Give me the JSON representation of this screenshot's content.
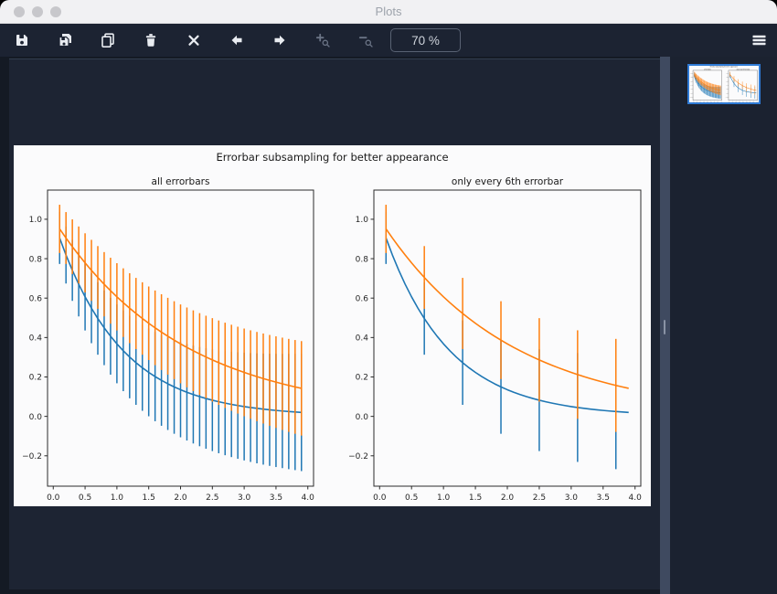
{
  "window": {
    "title": "Plots"
  },
  "toolbar": {
    "zoom_level": "70 %",
    "buttons": [
      {
        "name": "save",
        "icon": "save-icon",
        "enabled": true
      },
      {
        "name": "save-all",
        "icon": "save-all-icon",
        "enabled": true
      },
      {
        "name": "copy",
        "icon": "copy-icon",
        "enabled": true
      },
      {
        "name": "remove-plot",
        "icon": "trash-icon",
        "enabled": true
      },
      {
        "name": "close-all",
        "icon": "close-all-icon",
        "enabled": true
      },
      {
        "name": "previous-plot",
        "icon": "arrow-left-icon",
        "enabled": true
      },
      {
        "name": "next-plot",
        "icon": "arrow-right-icon",
        "enabled": true
      },
      {
        "name": "zoom-in",
        "icon": "zoom-in-icon",
        "enabled": false
      },
      {
        "name": "zoom-out",
        "icon": "zoom-out-icon",
        "enabled": false
      },
      {
        "name": "options-menu",
        "icon": "hamburger-menu-icon",
        "enabled": true
      }
    ]
  },
  "sidebar": {
    "thumbnails": [
      {
        "selected": true
      }
    ]
  },
  "colors": {
    "titlebar_bg": "#f1f1f3",
    "titlebar_text": "#9da3ab",
    "traffic_light": "#c7c7cb",
    "toolbar_bg": "#1c2332",
    "icon": "#e9ecf1",
    "icon_disabled": "#6b7486",
    "content_bg": "#141a24",
    "panel_bg": "#1d2433",
    "splitter": "#3f4a60",
    "sidebar_bg": "#1b2230",
    "thumbnail_border": "#2f7bd6",
    "figure_bg": "#fbfbfc",
    "spine": "#2b2b2b",
    "fig_text": "#1a1a1a",
    "tick_text": "#262626",
    "series_blue": "#1f77b4",
    "series_orange": "#ff7f0e",
    "zoom_box_border": "#596273",
    "zoom_box_text": "#ced3db"
  },
  "chart_data": {
    "type": "line",
    "suptitle": "Errorbar subsampling for better appearance",
    "subplots": [
      {
        "title": "all errorbars",
        "errorevery": 1
      },
      {
        "title": "only every 6th errorbar",
        "errorevery": 6
      }
    ],
    "x": [
      0.1,
      0.2,
      0.3,
      0.4,
      0.5,
      0.6,
      0.7,
      0.8,
      0.9,
      1.0,
      1.1,
      1.2,
      1.3,
      1.4,
      1.5,
      1.6,
      1.7,
      1.8,
      1.9,
      2.0,
      2.1,
      2.2,
      2.3,
      2.4,
      2.5,
      2.6,
      2.7,
      2.8,
      2.9,
      3.0,
      3.1,
      3.2,
      3.3,
      3.4,
      3.5,
      3.6,
      3.7,
      3.8,
      3.9
    ],
    "series": [
      {
        "color": "#1f77b4",
        "values": [
          0.9048,
          0.8187,
          0.7408,
          0.6703,
          0.6065,
          0.5488,
          0.4966,
          0.4493,
          0.4066,
          0.3679,
          0.3329,
          0.3012,
          0.2725,
          0.2466,
          0.2231,
          0.2019,
          0.1827,
          0.1653,
          0.1496,
          0.1353,
          0.1225,
          0.1108,
          0.1003,
          0.0907,
          0.0821,
          0.0743,
          0.0672,
          0.0608,
          0.055,
          0.0498,
          0.045,
          0.0408,
          0.0369,
          0.0334,
          0.0302,
          0.0273,
          0.0247,
          0.0224,
          0.0202
        ],
        "errors": [
          0.1316,
          0.1447,
          0.1548,
          0.1632,
          0.1707,
          0.1775,
          0.1837,
          0.1894,
          0.1949,
          0.2,
          0.2049,
          0.2095,
          0.214,
          0.2183,
          0.2225,
          0.2265,
          0.2304,
          0.2342,
          0.2378,
          0.2414,
          0.2449,
          0.2483,
          0.2517,
          0.2549,
          0.2581,
          0.2612,
          0.2643,
          0.2673,
          0.2702,
          0.2732,
          0.276,
          0.2789,
          0.2817,
          0.2844,
          0.2871,
          0.2897,
          0.2924,
          0.2949,
          0.2975
        ]
      },
      {
        "color": "#ff7f0e",
        "values": [
          0.9512,
          0.9048,
          0.8607,
          0.8187,
          0.7788,
          0.7408,
          0.7047,
          0.6703,
          0.6376,
          0.6065,
          0.5769,
          0.5488,
          0.522,
          0.4966,
          0.4724,
          0.4493,
          0.4274,
          0.4066,
          0.3867,
          0.3679,
          0.3499,
          0.3329,
          0.3166,
          0.3012,
          0.2865,
          0.2725,
          0.2592,
          0.2466,
          0.2346,
          0.2231,
          0.2122,
          0.2019,
          0.192,
          0.1827,
          0.1738,
          0.1653,
          0.1572,
          0.1496,
          0.1423
        ],
        "errors": [
          0.1224,
          0.1316,
          0.1387,
          0.1447,
          0.15,
          0.1548,
          0.1592,
          0.1632,
          0.1671,
          0.1707,
          0.1742,
          0.1775,
          0.1806,
          0.1837,
          0.1866,
          0.1894,
          0.1922,
          0.1949,
          0.1975,
          0.2,
          0.2025,
          0.2049,
          0.2072,
          0.2095,
          0.2118,
          0.214,
          0.2162,
          0.2183,
          0.2204,
          0.2225,
          0.2245,
          0.2265,
          0.2285,
          0.2304,
          0.2323,
          0.2342,
          0.236,
          0.2378,
          0.2396
        ]
      }
    ],
    "xlim": [
      -0.09,
      4.09
    ],
    "ylim": [
      -0.354,
      1.148
    ],
    "xticks": [
      0.0,
      0.5,
      1.0,
      1.5,
      2.0,
      2.5,
      3.0,
      3.5,
      4.0
    ],
    "yticks": [
      -0.2,
      0.0,
      0.2,
      0.4,
      0.6,
      0.8,
      1.0
    ],
    "xtick_labels": [
      "0.0",
      "0.5",
      "1.0",
      "1.5",
      "2.0",
      "2.5",
      "3.0",
      "3.5",
      "4.0"
    ],
    "ytick_labels": [
      "−0.2",
      "0.0",
      "0.2",
      "0.4",
      "0.6",
      "0.8",
      "1.0"
    ],
    "grid": false,
    "legend": "none"
  }
}
